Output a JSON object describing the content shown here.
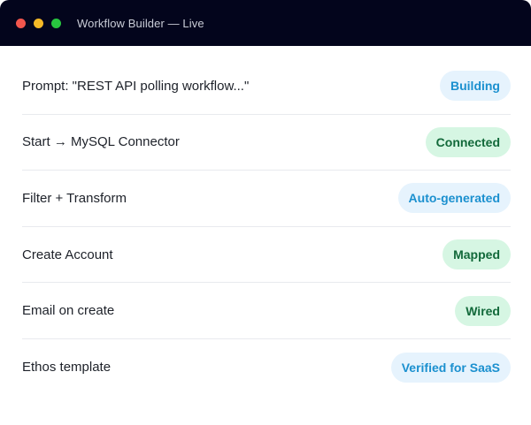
{
  "window": {
    "title": "Workflow Builder — Live"
  },
  "colors": {
    "titlebar": "#03051c",
    "close": "#f2564d",
    "minimize": "#f5b927",
    "maximize": "#28c63f",
    "badge_blue_bg": "#e6f3fd",
    "badge_blue_text": "#1b90cf",
    "badge_green_bg": "#d6f6e3",
    "badge_green_text": "#12693a"
  },
  "steps": [
    {
      "label": "Prompt: \"REST API polling workflow...\"",
      "status": "Building",
      "tone": "blue"
    },
    {
      "label": "Start → MySQL Connector",
      "status": "Connected",
      "tone": "green"
    },
    {
      "label": "Filter + Transform",
      "status": "Auto-generated",
      "tone": "blue"
    },
    {
      "label": "Create Account",
      "status": "Mapped",
      "tone": "green"
    },
    {
      "label": "Email on create",
      "status": "Wired",
      "tone": "green"
    },
    {
      "label": "Ethos template",
      "status": "Verified for SaaS",
      "tone": "blue"
    }
  ]
}
